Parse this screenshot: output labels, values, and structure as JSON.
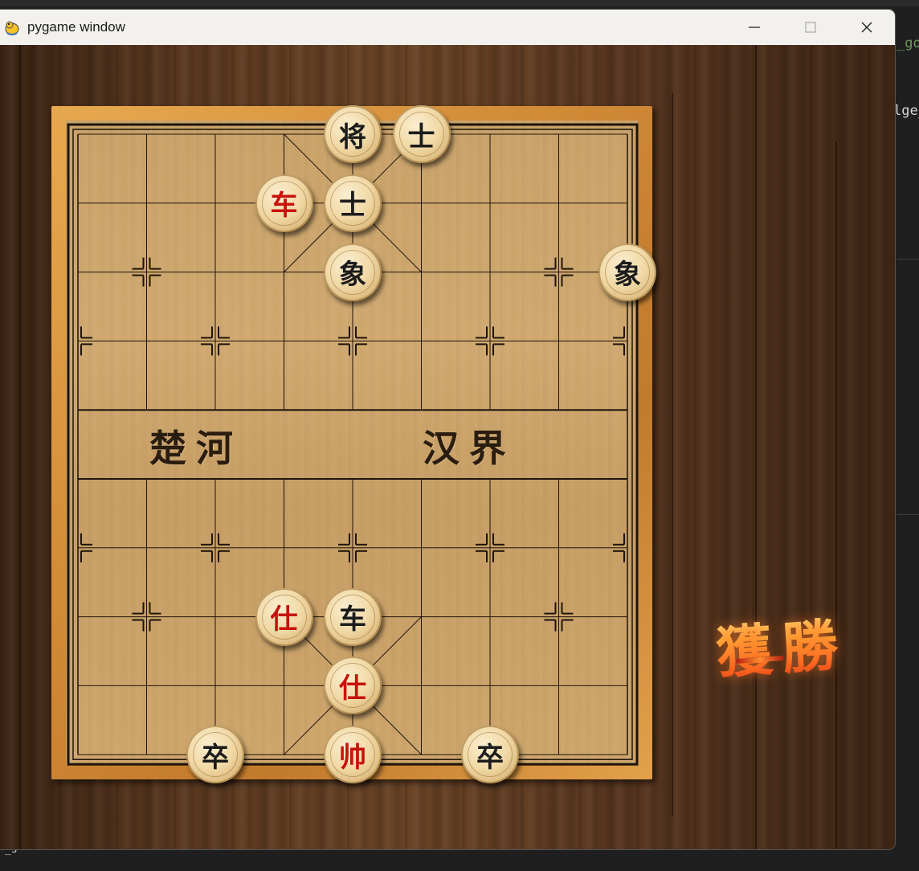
{
  "window": {
    "title": "pygame window",
    "icon": "pygame-snake-icon",
    "controls": {
      "minimize_icon": "minimize-icon",
      "maximize_icon": "maximize-icon",
      "close_icon": "close-icon"
    }
  },
  "background_editor": {
    "fragments": [
      "_go",
      "lge_",
      "_s"
    ]
  },
  "board": {
    "river_left": "楚河",
    "river_right": "汉界",
    "colors": {
      "red_piece_text": "#c8120c",
      "black_piece_text": "#1c1c1c",
      "board_wood": "#caa46c",
      "frame_wood": "#d18a36"
    }
  },
  "pieces": [
    {
      "label": "将",
      "side": "black",
      "col": 4,
      "row": 0
    },
    {
      "label": "士",
      "side": "black",
      "col": 5,
      "row": 0
    },
    {
      "label": "车",
      "side": "red",
      "col": 3,
      "row": 1
    },
    {
      "label": "士",
      "side": "black",
      "col": 4,
      "row": 1
    },
    {
      "label": "象",
      "side": "black",
      "col": 4,
      "row": 2
    },
    {
      "label": "象",
      "side": "black",
      "col": 8,
      "row": 2
    },
    {
      "label": "仕",
      "side": "red",
      "col": 3,
      "row": 7
    },
    {
      "label": "车",
      "side": "black",
      "col": 4,
      "row": 7
    },
    {
      "label": "仕",
      "side": "red",
      "col": 4,
      "row": 8
    },
    {
      "label": "卒",
      "side": "black",
      "col": 2,
      "row": 9
    },
    {
      "label": "帅",
      "side": "red",
      "col": 4,
      "row": 9
    },
    {
      "label": "卒",
      "side": "black",
      "col": 6,
      "row": 9
    }
  ],
  "victory_banner": {
    "text": "獲勝"
  }
}
